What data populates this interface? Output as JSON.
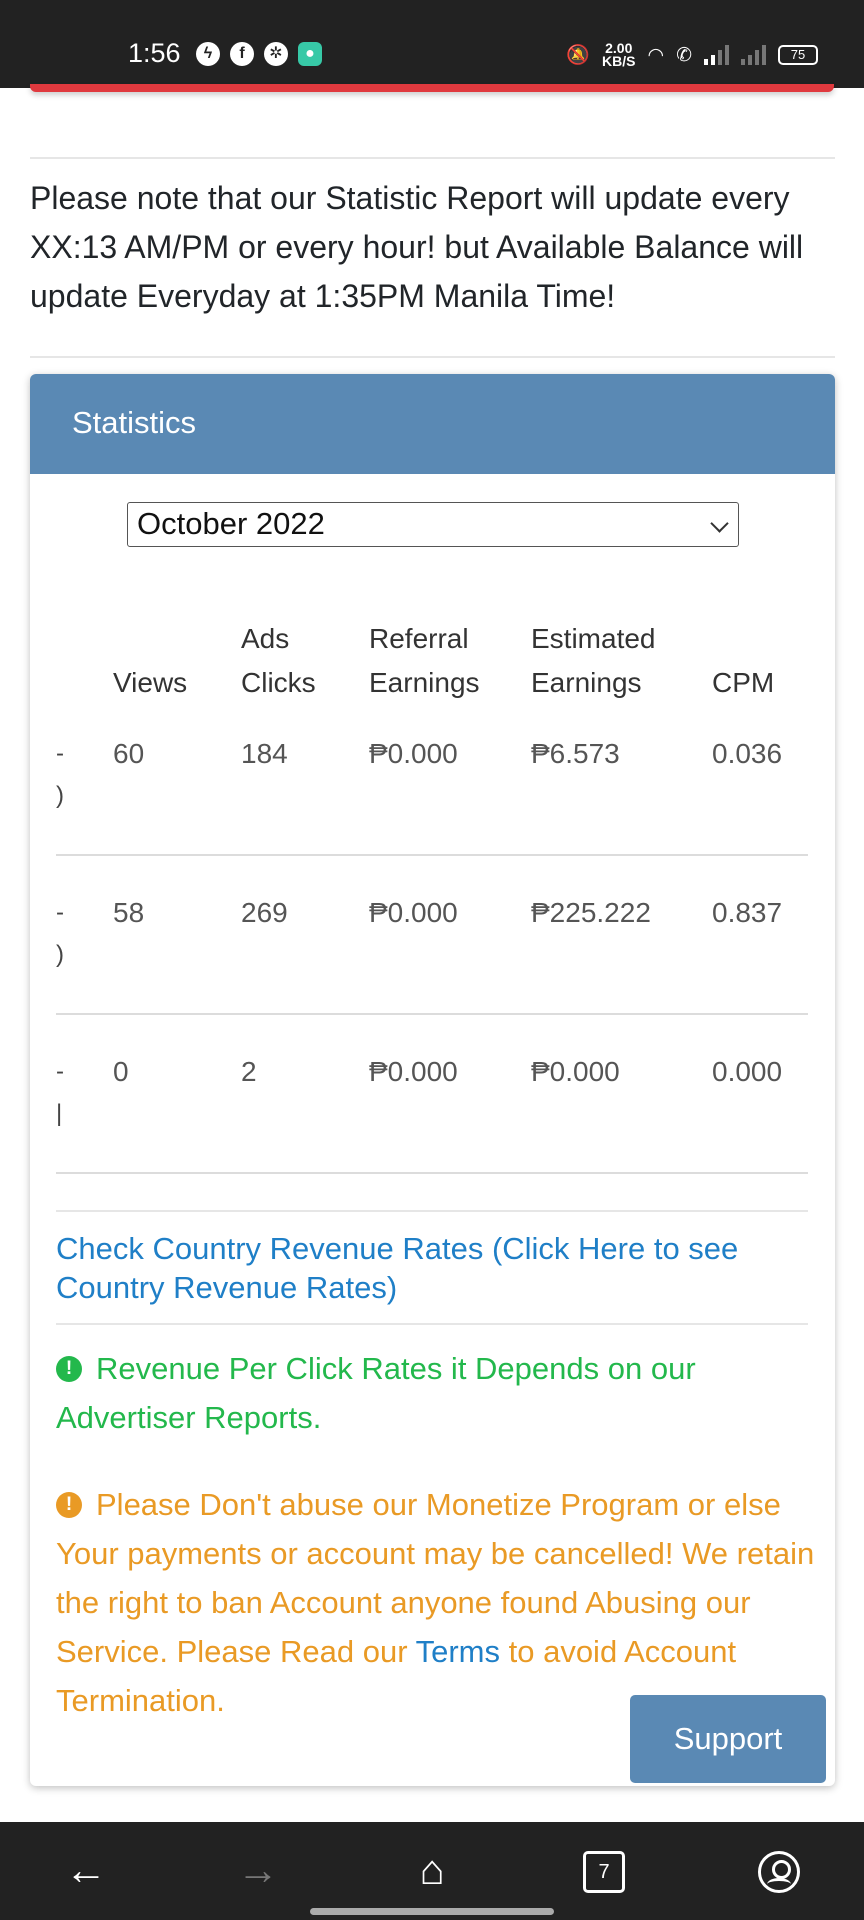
{
  "status_bar": {
    "time": "1:56",
    "speed_value": "2.00",
    "speed_unit": "KB/S",
    "battery": "75",
    "icons": [
      "messenger-icon",
      "facebook-icon",
      "pinwheel-icon",
      "app-icon",
      "vibrate-icon",
      "wifi-icon",
      "wifi-calling-icon",
      "signal-icon",
      "signal-icon"
    ]
  },
  "notice_text": "Please note that our Statistic Report will update every XX:13 AM/PM or every hour! but Available Balance will update Everyday at 1:35PM Manila Time!",
  "statistics": {
    "title": "Statistics",
    "month_select": "October 2022",
    "headers": {
      "views": "Views",
      "ads_clicks_1": "Ads",
      "ads_clicks_2": "Clicks",
      "referral_1": "Referral",
      "referral_2": "Earnings",
      "estimated_1": "Estimated",
      "estimated_2": "Earnings",
      "cpm": "CPM"
    },
    "rows": [
      {
        "cut_1": "-",
        "cut_2": ")",
        "views": "60",
        "ads_clicks": "184",
        "referral_earnings": "₱0.000",
        "estimated_earnings": "₱6.573",
        "cpm": "0.036"
      },
      {
        "cut_1": "-",
        "cut_2": ")",
        "views": "58",
        "ads_clicks": "269",
        "referral_earnings": "₱0.000",
        "estimated_earnings": "₱225.222",
        "cpm": "0.837"
      },
      {
        "cut_1": "-",
        "cut_2": "|",
        "views": "0",
        "ads_clicks": "2",
        "referral_earnings": "₱0.000",
        "estimated_earnings": "₱0.000",
        "cpm": "0.000"
      }
    ],
    "country_link": "Check Country Revenue Rates (Click Here to see Country Revenue Rates)",
    "info_message": "Revenue Per Click Rates it Depends on our Advertiser Reports.",
    "warning_message_before": "Please Don't abuse our Monetize Program or else Your payments or account may be cancelled! We retain the right to ban Account anyone found Abusing our Service. Please Read our",
    "terms_link": "Terms",
    "warning_message_after": "to avoid Account Termination.",
    "badge_symbol": "!",
    "support_button": "Support"
  },
  "nav_bar": {
    "back": "←",
    "forward": "→",
    "home": "⌂",
    "tab_count": "7"
  },
  "colors": {
    "header": "#5a89b4",
    "link": "#1f7fc7",
    "success": "#23b84c",
    "warning": "#e99a25",
    "danger": "#e0393e"
  }
}
